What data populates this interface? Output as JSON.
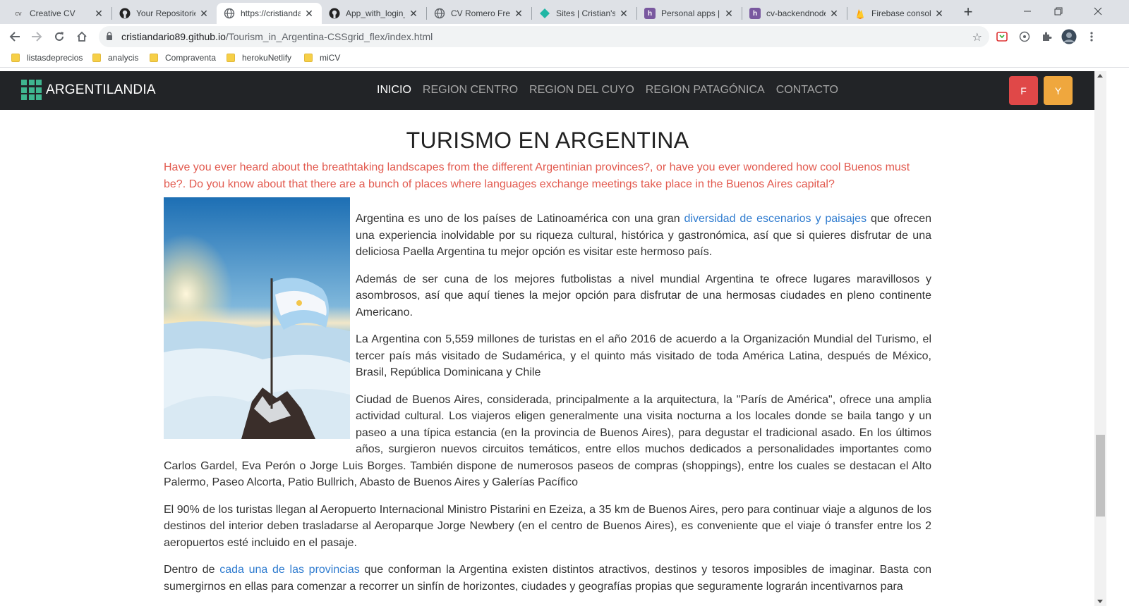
{
  "browser": {
    "tabs": [
      {
        "title": "Creative CV",
        "favicon": "cv-icon"
      },
      {
        "title": "Your Repositorie",
        "favicon": "github-icon"
      },
      {
        "title": "https://cristianda",
        "favicon": "globe-icon",
        "active": true
      },
      {
        "title": "App_with_login_",
        "favicon": "github-icon"
      },
      {
        "title": "CV Romero Free",
        "favicon": "globe-icon"
      },
      {
        "title": "Sites | Cristian's",
        "favicon": "netlify-icon"
      },
      {
        "title": "Personal apps | H",
        "favicon": "heroku-icon"
      },
      {
        "title": "cv-backendnode",
        "favicon": "heroku-icon"
      },
      {
        "title": "Firebase console",
        "favicon": "firebase-icon"
      }
    ],
    "url_host": "cristiandario89.github.io",
    "url_path": "/Tourism_in_Argentina-CSSgrid_flex/index.html",
    "bookmarks": [
      "listasdeprecios",
      "analycis",
      "Compraventa",
      "herokuNetlify",
      "miCV"
    ]
  },
  "site": {
    "brand": "ARGENTILANDIA",
    "nav": [
      {
        "label": "INICIO",
        "active": true
      },
      {
        "label": "REGION CENTRO"
      },
      {
        "label": "REGION DEL CUYO"
      },
      {
        "label": "REGION PATAGÓNICA"
      },
      {
        "label": "CONTACTO"
      }
    ],
    "social": [
      {
        "label": "F",
        "color": "#e04848"
      },
      {
        "label": "Y",
        "color": "#efa73e"
      }
    ]
  },
  "content": {
    "title": "TURISMO EN ARGENTINA",
    "intro": "Have you ever heard about the breathtaking landscapes from the different Argentinian provinces?, or have you ever wondered how cool Buenos must be?. Do you know about that there are a bunch of places where languages exchange meetings take place in the Buenos Aires capital?",
    "p1_before": "Argentina es uno de los países de Latinoamérica con una gran ",
    "p1_link": "diversidad de escenarios y paisajes",
    "p1_after": " que ofrecen una experiencia inolvidable por su riqueza cultural, histórica y gastronómica, así que si quieres disfrutar de una deliciosa Paella Argentina tu mejor opción es visitar este hermoso país.",
    "p2": "Además de ser cuna de los mejores futbolistas a nivel mundial Argentina te ofrece lugares maravillosos y asombrosos, así que aquí tienes la mejor opción para disfrutar de una hermosas ciudades en pleno continente Americano.",
    "p3": "La Argentina con 5,559 millones de turistas en el año 2016 de acuerdo a la Organización Mundial del Turismo, el tercer país más visitado de Sudamérica, y el quinto más visitado de toda América Latina, después de México, Brasil, República Dominicana y Chile",
    "p4": "Ciudad de Buenos Aires, considerada, principalmente a la arquitectura, la \"París de América\", ofrece una amplia actividad cultural. Los viajeros eligen generalmente una visita nocturna a los locales donde se baila tango y un paseo a una típica estancia (en la provincia de Buenos Aires), para degustar el tradicional asado. En los últimos años, surgieron nuevos circuitos temáticos, entre ellos muchos dedicados a personalidades importantes como Carlos Gardel, Eva Perón o Jorge Luis Borges. También dispone de numerosos paseos de compras (shoppings), entre los cuales se destacan el Alto Palermo, Paseo Alcorta, Patio Bullrich, Abasto de Buenos Aires y Galerías Pacífico",
    "p5": "El 90% de los turistas llegan al Aeropuerto Internacional Ministro Pistarini en Ezeiza, a 35 km de Buenos Aires, pero para continuar viaje a algunos de los destinos del interior deben trasladarse al Aeroparque Jorge Newbery (en el centro de Buenos Aires), es conveniente que el viaje ó transfer entre los 2 aeropuertos esté incluido en el pasaje.",
    "p6_before": "Dentro de ",
    "p6_link": "cada una de las provincias",
    "p6_after": " que conforman la Argentina existen distintos atractivos, destinos y tesoros imposibles de imaginar. Basta con sumergirnos en ellas para comenzar a recorrer un sinfín de horizontes, ciudades y geografías propias que seguramente lograrán incentivarnos para"
  }
}
